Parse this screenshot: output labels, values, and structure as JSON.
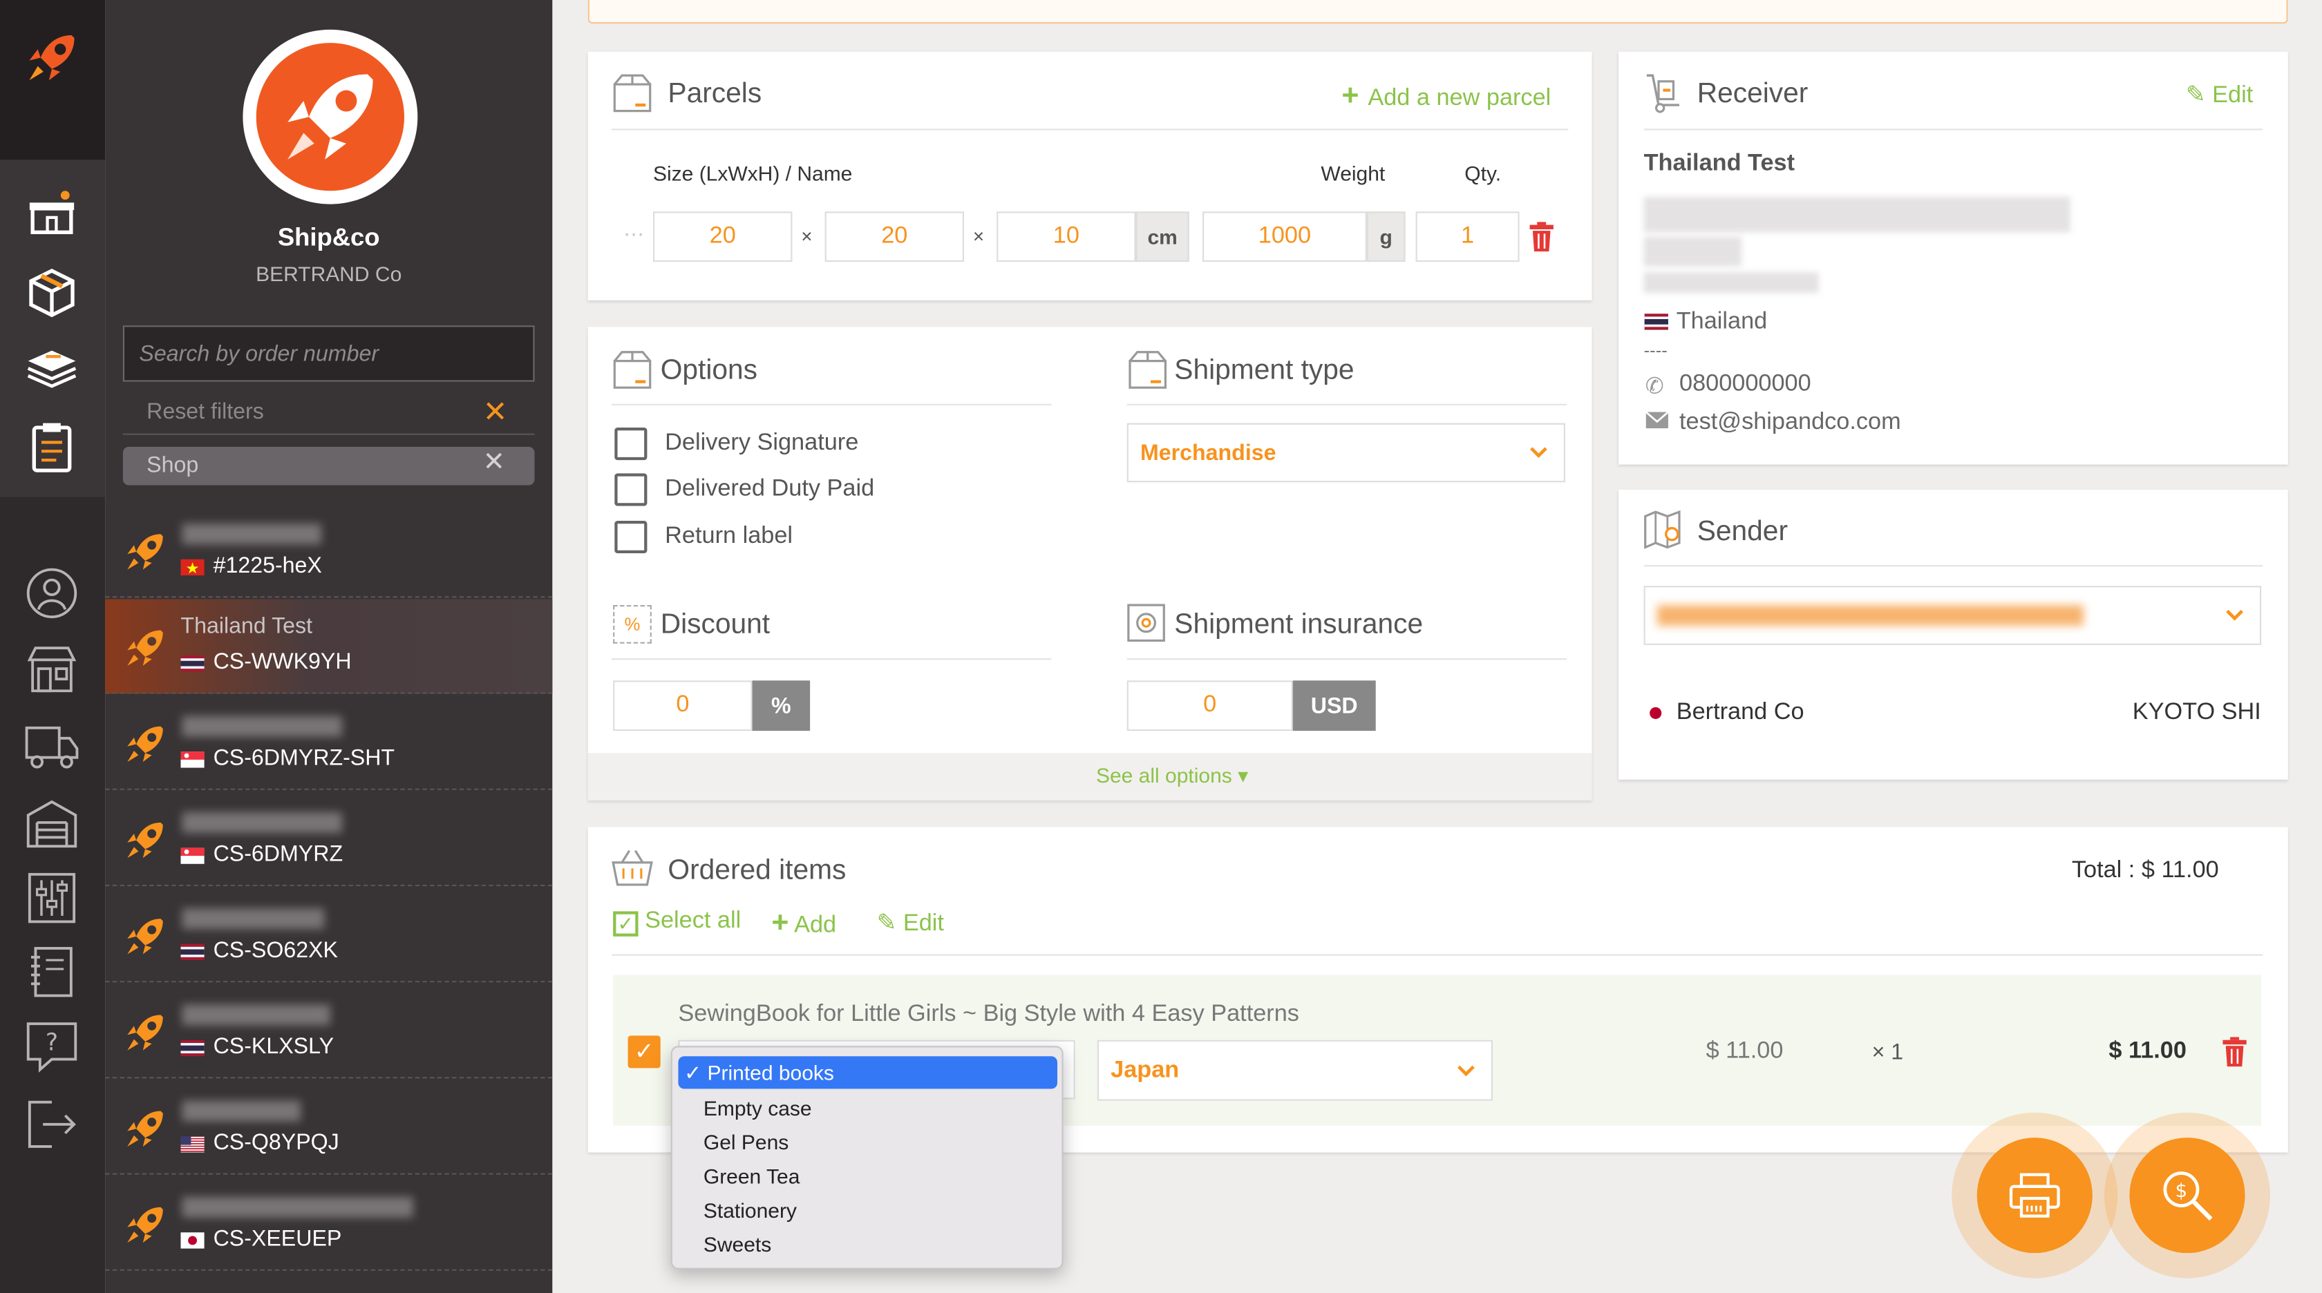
{
  "sidebar": {
    "company": "Ship&co",
    "subcompany": "BERTRAND Co",
    "search_placeholder": "Search by order number",
    "reset_filters": "Reset filters",
    "shop_filter": "Shop",
    "orders": [
      {
        "name": "",
        "code": "#1225-heX",
        "flag": "vn"
      },
      {
        "name": "Thailand Test",
        "code": "CS-WWK9YH",
        "flag": "th"
      },
      {
        "name": "",
        "code": "CS-6DMYRZ-SHT",
        "flag": "sg"
      },
      {
        "name": "",
        "code": "CS-6DMYRZ",
        "flag": "sg"
      },
      {
        "name": "",
        "code": "CS-SO62XK",
        "flag": "th"
      },
      {
        "name": "",
        "code": "CS-KLXSLY",
        "flag": "th"
      },
      {
        "name": "",
        "code": "CS-Q8YPQJ",
        "flag": "us"
      },
      {
        "name": "",
        "code": "CS-XEEUEP",
        "flag": "jp"
      }
    ]
  },
  "parcels": {
    "title": "Parcels",
    "add_label": "Add a new parcel",
    "col_size": "Size (LxWxH) / Name",
    "col_weight": "Weight",
    "col_qty": "Qty.",
    "length": "20",
    "width": "20",
    "height": "10",
    "dim_unit": "cm",
    "weight": "1000",
    "weight_unit": "g",
    "qty": "1",
    "times": "×"
  },
  "options": {
    "title": "Options",
    "items": [
      "Delivery Signature",
      "Delivered Duty Paid",
      "Return label"
    ],
    "discount_title": "Discount",
    "discount_value": "0",
    "discount_unit": "%",
    "see_all": "See all options ▾"
  },
  "shipment": {
    "title": "Shipment type",
    "type": "Merchandise",
    "insurance_title": "Shipment insurance",
    "insurance_value": "0",
    "insurance_unit": "USD"
  },
  "receiver": {
    "title": "Receiver",
    "edit": "Edit",
    "name": "Thailand Test",
    "country": "Thailand",
    "dashes": "----",
    "phone": "0800000000",
    "email": "test@shipandco.com"
  },
  "sender": {
    "title": "Sender",
    "name": "Bertrand Co",
    "city": "KYOTO SHI"
  },
  "ordered": {
    "title": "Ordered items",
    "total": "Total : $ 11.00",
    "select_all": "Select all",
    "add": "Add",
    "edit": "Edit",
    "item_title": "SewingBook for Little Girls ~ Big Style with 4 Easy Patterns",
    "origin": "Japan",
    "price": "$ 11.00",
    "qty": "× 1",
    "line_total": "$ 11.00"
  },
  "category_dropdown": {
    "selected": "✓ Printed books",
    "options": [
      "Empty case",
      "Gel Pens",
      "Green Tea",
      "Stationery",
      "Sweets"
    ]
  },
  "colors": {
    "accent": "#f7931e",
    "brand": "#f05a22",
    "green": "#8bc34a",
    "delete": "#e53935"
  }
}
